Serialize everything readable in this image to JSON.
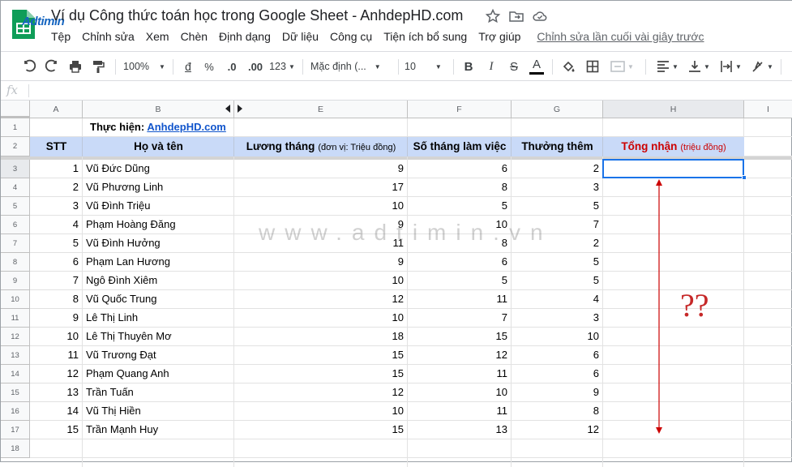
{
  "document": {
    "title": "Ví dụ Công thức toán học trong Google Sheet - AnhdepHD.com",
    "logo_text": "Adtimin"
  },
  "menu": [
    "Tệp",
    "Chỉnh sửa",
    "Xem",
    "Chèn",
    "Định dạng",
    "Dữ liệu",
    "Công cụ",
    "Tiện ích bổ sung",
    "Trợ giúp"
  ],
  "last_edit": "Chỉnh sửa lần cuối vài giây trước",
  "toolbar": {
    "zoom": "100%",
    "currency": "đ",
    "percent": "%",
    "dec_decrease": ".0",
    "dec_increase": ".00",
    "more_formats": "123",
    "font": "Mặc định (...",
    "font_size": "10",
    "bold": "B",
    "italic": "I",
    "strike": "S",
    "text_color": "A",
    "text_color_value": "#000000"
  },
  "formula_bar": {
    "fx": "fx"
  },
  "columns": [
    "A",
    "B",
    "E",
    "F",
    "G",
    "H",
    "I"
  ],
  "row_numbers": [
    "1",
    "2",
    "3",
    "4",
    "5",
    "6",
    "7",
    "8",
    "9",
    "10",
    "11",
    "12",
    "13",
    "14",
    "15",
    "16",
    "17",
    "18"
  ],
  "sheet": {
    "row1_label": "Thực hiện: ",
    "row1_link": "AnhdepHD.com",
    "headers": {
      "stt": "STT",
      "name": "Họ và tên",
      "salary": "Lương tháng",
      "salary_unit": "(đơn vị: Triệu đồng)",
      "months": "Số tháng làm việc",
      "bonus": "Thưởng thêm",
      "total": "Tổng nhận",
      "total_unit": "(triệu đồng)"
    },
    "rows": [
      [
        "1",
        "Vũ Đức Dũng",
        "9",
        "6",
        "2"
      ],
      [
        "2",
        "Vũ Phương Linh",
        "17",
        "8",
        "3"
      ],
      [
        "3",
        "Vũ Đình Triệu",
        "10",
        "5",
        "5"
      ],
      [
        "4",
        "Phạm Hoàng Đăng",
        "9",
        "10",
        "7"
      ],
      [
        "5",
        "Vũ Đình Hưởng",
        "11",
        "8",
        "2"
      ],
      [
        "6",
        "Phạm Lan Hương",
        "9",
        "6",
        "5"
      ],
      [
        "7",
        "Ngô Đình Xiêm",
        "10",
        "5",
        "5"
      ],
      [
        "8",
        "Vũ Quốc Trung",
        "12",
        "11",
        "4"
      ],
      [
        "9",
        "Lê Thị Linh",
        "10",
        "7",
        "3"
      ],
      [
        "10",
        "Lê Thị Thuyên Mơ",
        "18",
        "15",
        "10"
      ],
      [
        "11",
        "Vũ Trương Đạt",
        "15",
        "12",
        "6"
      ],
      [
        "12",
        "Phạm Quang Anh",
        "15",
        "11",
        "6"
      ],
      [
        "13",
        "Trần Tuấn",
        "12",
        "10",
        "9"
      ],
      [
        "14",
        "Vũ Thị Hiền",
        "10",
        "11",
        "8"
      ],
      [
        "15",
        "Trần Mạnh Huy",
        "15",
        "13",
        "12"
      ]
    ]
  },
  "overlay": {
    "watermark": "www.adtimin.vn",
    "question": "??"
  },
  "colors": {
    "header_fill": "#c9daf8",
    "total_header_text": "#cc0000",
    "selection": "#1a73e8",
    "link": "#1155cc",
    "arrow": "#cc0000"
  }
}
